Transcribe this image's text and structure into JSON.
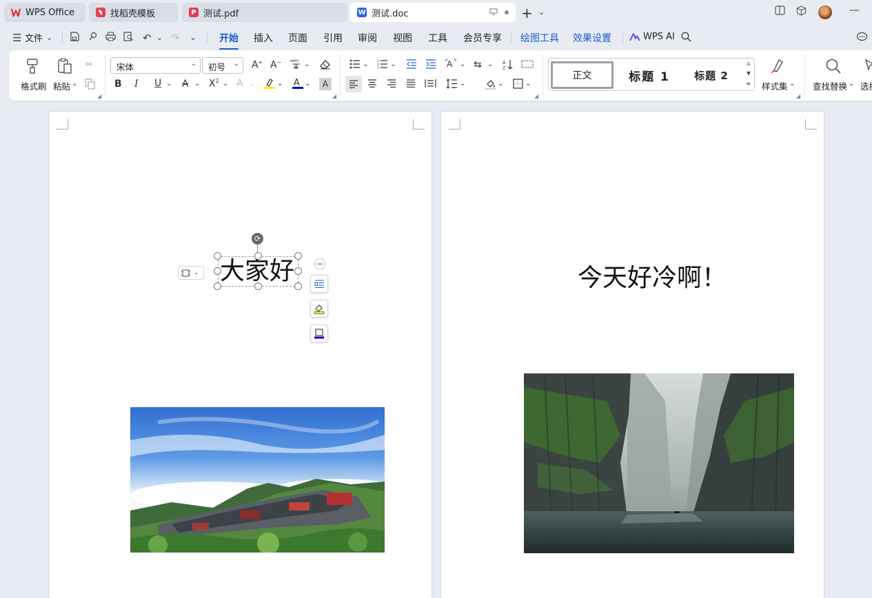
{
  "tabs": [
    {
      "label": "WPS Office",
      "icon": "wps-logo-icon"
    },
    {
      "label": "找稻壳模板",
      "icon": "docer-icon"
    },
    {
      "label": "测试.pdf",
      "icon": "pdf-icon"
    },
    {
      "label": "测试.doc",
      "icon": "word-doc-icon",
      "active": true
    }
  ],
  "menu": {
    "file": "文件",
    "items": [
      "开始",
      "插入",
      "页面",
      "引用",
      "审阅",
      "视图",
      "工具",
      "会员专享"
    ],
    "active": "开始",
    "context_items": [
      "绘图工具",
      "效果设置"
    ],
    "ai": "WPS AI"
  },
  "ribbon": {
    "format_painter": "格式刷",
    "paste": "粘贴",
    "font_name": "宋体",
    "font_size": "初号",
    "styles": [
      "正文",
      "标题 1",
      "标题 2"
    ],
    "style_set": "样式集",
    "find_replace": "查找替换",
    "select": "选择"
  },
  "document": {
    "page1": {
      "textbox_text": "大家好"
    },
    "page2": {
      "heading_text": "今天好冷啊！"
    }
  },
  "colors": {
    "accent": "#1a5bd6",
    "highlight_yellow": "#ffee00",
    "font_color_blue": "#0000cc"
  }
}
